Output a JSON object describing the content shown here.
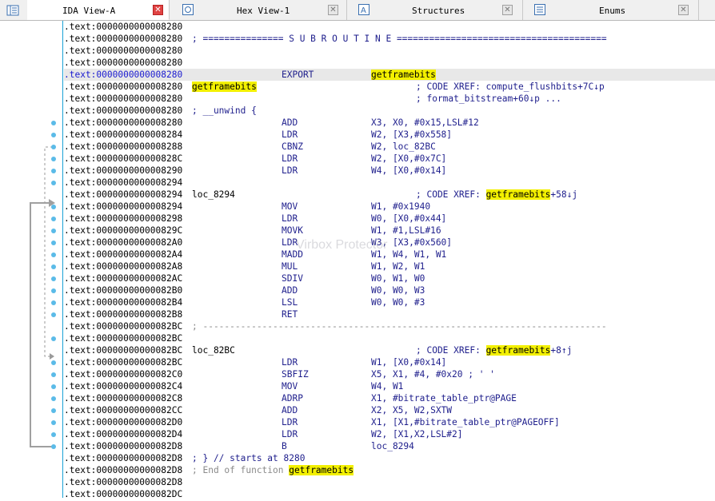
{
  "tabs": [
    {
      "label": "IDA View-A",
      "icon": "ida-view-icon",
      "active": true
    },
    {
      "label": "Hex View-1",
      "icon": "hex-view-icon",
      "active": false
    },
    {
      "label": "Structures",
      "icon": "structures-icon",
      "active": false
    },
    {
      "label": "Enums",
      "icon": "enums-icon",
      "active": false
    }
  ],
  "watermark": "Virbox Protector",
  "lines": [
    {
      "addr": ".text:0000000000008280"
    },
    {
      "addr": ".text:0000000000008280",
      "sub": "; =============== S U B R O U T I N E ======================================="
    },
    {
      "addr": ".text:0000000000008280"
    },
    {
      "addr": ".text:0000000000008280"
    },
    {
      "addr": ".text:0000000000008280",
      "current": true,
      "mn": "EXPORT",
      "op_pre": "",
      "op_hl": "getframebits",
      "op_post": ""
    },
    {
      "addr": ".text:0000000000008280",
      "label_hl": "getframebits",
      "cmt": "; CODE XREF: compute_flushbits+7C↓p"
    },
    {
      "addr": ".text:0000000000008280",
      "cmt": "; format_bitstream+60↓p ..."
    },
    {
      "addr": ".text:0000000000008280",
      "sub": "; __unwind {"
    },
    {
      "addr": ".text:0000000000008280",
      "mn": "ADD",
      "op": "X3, X0, #0x15,LSL#12"
    },
    {
      "addr": ".text:0000000000008284",
      "mn": "LDR",
      "op": "W2, [X3,#0x558]"
    },
    {
      "addr": ".text:0000000000008288",
      "mn": "CBNZ",
      "op": "W2, loc_82BC"
    },
    {
      "addr": ".text:000000000000828C",
      "mn": "LDR",
      "op": "W2, [X0,#0x7C]"
    },
    {
      "addr": ".text:0000000000008290",
      "mn": "LDR",
      "op": "W4, [X0,#0x14]"
    },
    {
      "addr": ".text:0000000000008294"
    },
    {
      "addr": ".text:0000000000008294",
      "label": "loc_8294",
      "cmt_pre": "; CODE XREF: ",
      "cmt_hl": "getframebits",
      "cmt_post": "+58↓j"
    },
    {
      "addr": ".text:0000000000008294",
      "mn": "MOV",
      "op": "W1, #0x1940"
    },
    {
      "addr": ".text:0000000000008298",
      "mn": "LDR",
      "op": "W0, [X0,#0x44]"
    },
    {
      "addr": ".text:000000000000829C",
      "mn": "MOVK",
      "op": "W1, #1,LSL#16"
    },
    {
      "addr": ".text:00000000000082A0",
      "mn": "LDR",
      "op": "W3, [X3,#0x560]"
    },
    {
      "addr": ".text:00000000000082A4",
      "mn": "MADD",
      "op": "W1, W4, W1, W1"
    },
    {
      "addr": ".text:00000000000082A8",
      "mn": "MUL",
      "op": "W1, W2, W1"
    },
    {
      "addr": ".text:00000000000082AC",
      "mn": "SDIV",
      "op": "W0, W1, W0"
    },
    {
      "addr": ".text:00000000000082B0",
      "mn": "ADD",
      "op": "W0, W0, W3"
    },
    {
      "addr": ".text:00000000000082B4",
      "mn": "LSL",
      "op": "W0, W0, #3"
    },
    {
      "addr": ".text:00000000000082B8",
      "mn": "RET"
    },
    {
      "addr": ".text:00000000000082BC",
      "sep": "; ---------------------------------------------------------------------------"
    },
    {
      "addr": ".text:00000000000082BC"
    },
    {
      "addr": ".text:00000000000082BC",
      "label": "loc_82BC",
      "cmt_pre": "; CODE XREF: ",
      "cmt_hl": "getframebits",
      "cmt_post": "+8↑j"
    },
    {
      "addr": ".text:00000000000082BC",
      "mn": "LDR",
      "op": "W1, [X0,#0x14]"
    },
    {
      "addr": ".text:00000000000082C0",
      "mn": "SBFIZ",
      "op": "X5, X1, #4, #0x20 ; ' '"
    },
    {
      "addr": ".text:00000000000082C4",
      "mn": "MOV",
      "op": "W4, W1"
    },
    {
      "addr": ".text:00000000000082C8",
      "mn": "ADRP",
      "op": "X1, #bitrate_table_ptr@PAGE"
    },
    {
      "addr": ".text:00000000000082CC",
      "mn": "ADD",
      "op": "X2, X5, W2,SXTW"
    },
    {
      "addr": ".text:00000000000082D0",
      "mn": "LDR",
      "op": "X1, [X1,#bitrate_table_ptr@PAGEOFF]"
    },
    {
      "addr": ".text:00000000000082D4",
      "mn": "LDR",
      "op": "W2, [X1,X2,LSL#2]"
    },
    {
      "addr": ".text:00000000000082D8",
      "mn": "B",
      "op": "loc_8294"
    },
    {
      "addr": ".text:00000000000082D8",
      "sub": "; } // starts at 8280"
    },
    {
      "addr": ".text:00000000000082D8",
      "end_pre": "; End of function ",
      "end_hl": "getframebits"
    },
    {
      "addr": ".text:00000000000082D8"
    },
    {
      "addr": ".text:00000000000082DC"
    }
  ]
}
